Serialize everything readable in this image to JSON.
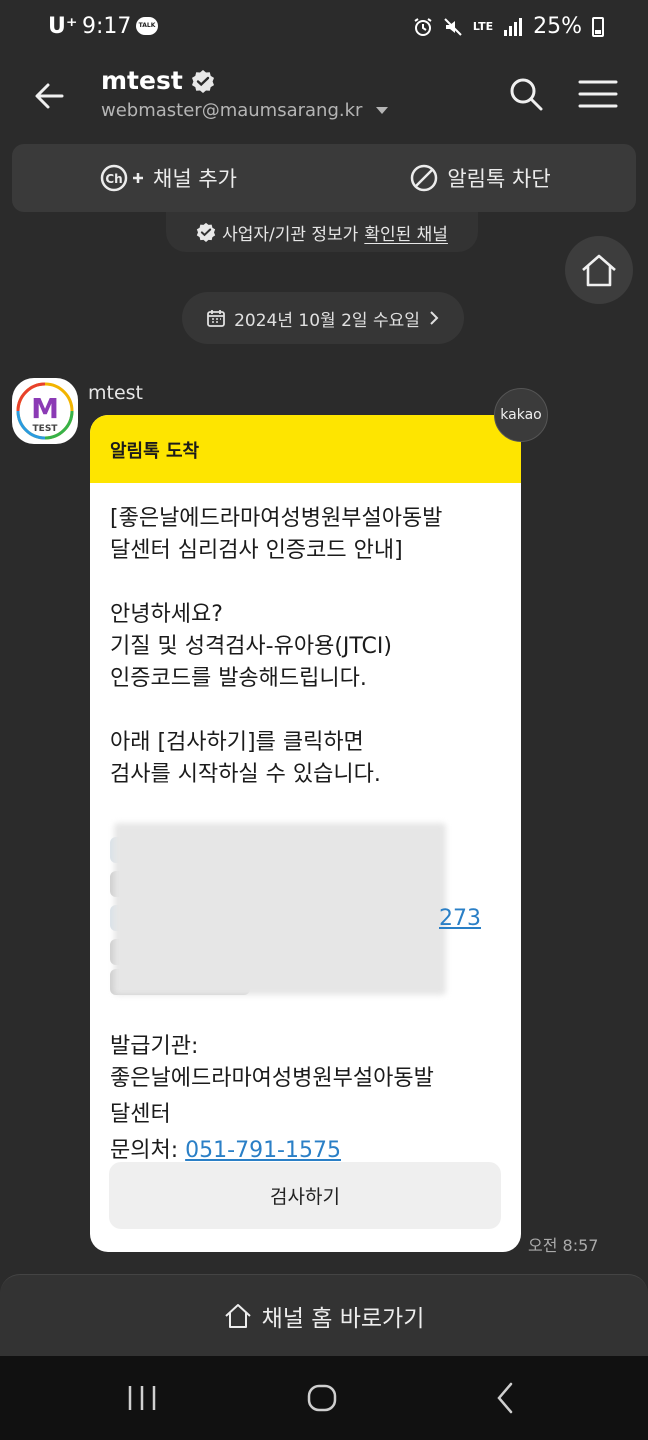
{
  "status_bar": {
    "carrier": "U⁺",
    "time": "9:17",
    "talk_badge": "TALK",
    "network": "LTE",
    "battery": "25%"
  },
  "header": {
    "title": "mtest",
    "subtitle": "webmaster@maumsarang.kr",
    "back_icon": "arrow-left-icon",
    "search_icon": "search-icon",
    "menu_icon": "hamburger-menu-icon"
  },
  "actions": {
    "add_channel": "채널 추가",
    "block_alimtalk": "알림톡 차단"
  },
  "biz_notice": {
    "prefix": "사업자/기관 정보가",
    "link": "확인된 채널"
  },
  "date_divider": "2024년 10월 2일 수요일",
  "message": {
    "sender": "mtest",
    "avatar_letter": "M",
    "avatar_text": "TEST",
    "badge": "kakao",
    "header": "알림톡 도착",
    "p1_l1": "[좋은날에드라마여성병원부설아동발",
    "p1_l2": "달센터 심리검사 인증코드 안내]",
    "p2_l1": "안녕하세요?",
    "p2_l2": "기질 및 성격검사-유아용(JTCI)",
    "p2_l3": "인증코드를 발송해드립니다.",
    "p3_l1": "아래 [검사하기]를 클릭하면",
    "p3_l2": "검사를 시작하실 수 있습니다.",
    "masked_link_tail": "273",
    "issuer_label": "발급기관:",
    "issuer_l1": "좋은날에드라마여성병원부설아동발",
    "issuer_l2": "달센터",
    "contact_label": "문의처: ",
    "contact_phone": "051-791-1575",
    "cta": "검사하기",
    "time": "오전 8:57"
  },
  "bottom": {
    "channel_home": "채널 홈 바로가기"
  },
  "colors": {
    "background": "#2b2b2b",
    "kakao_yellow": "#fee500",
    "link_blue": "#2a7fc6"
  }
}
